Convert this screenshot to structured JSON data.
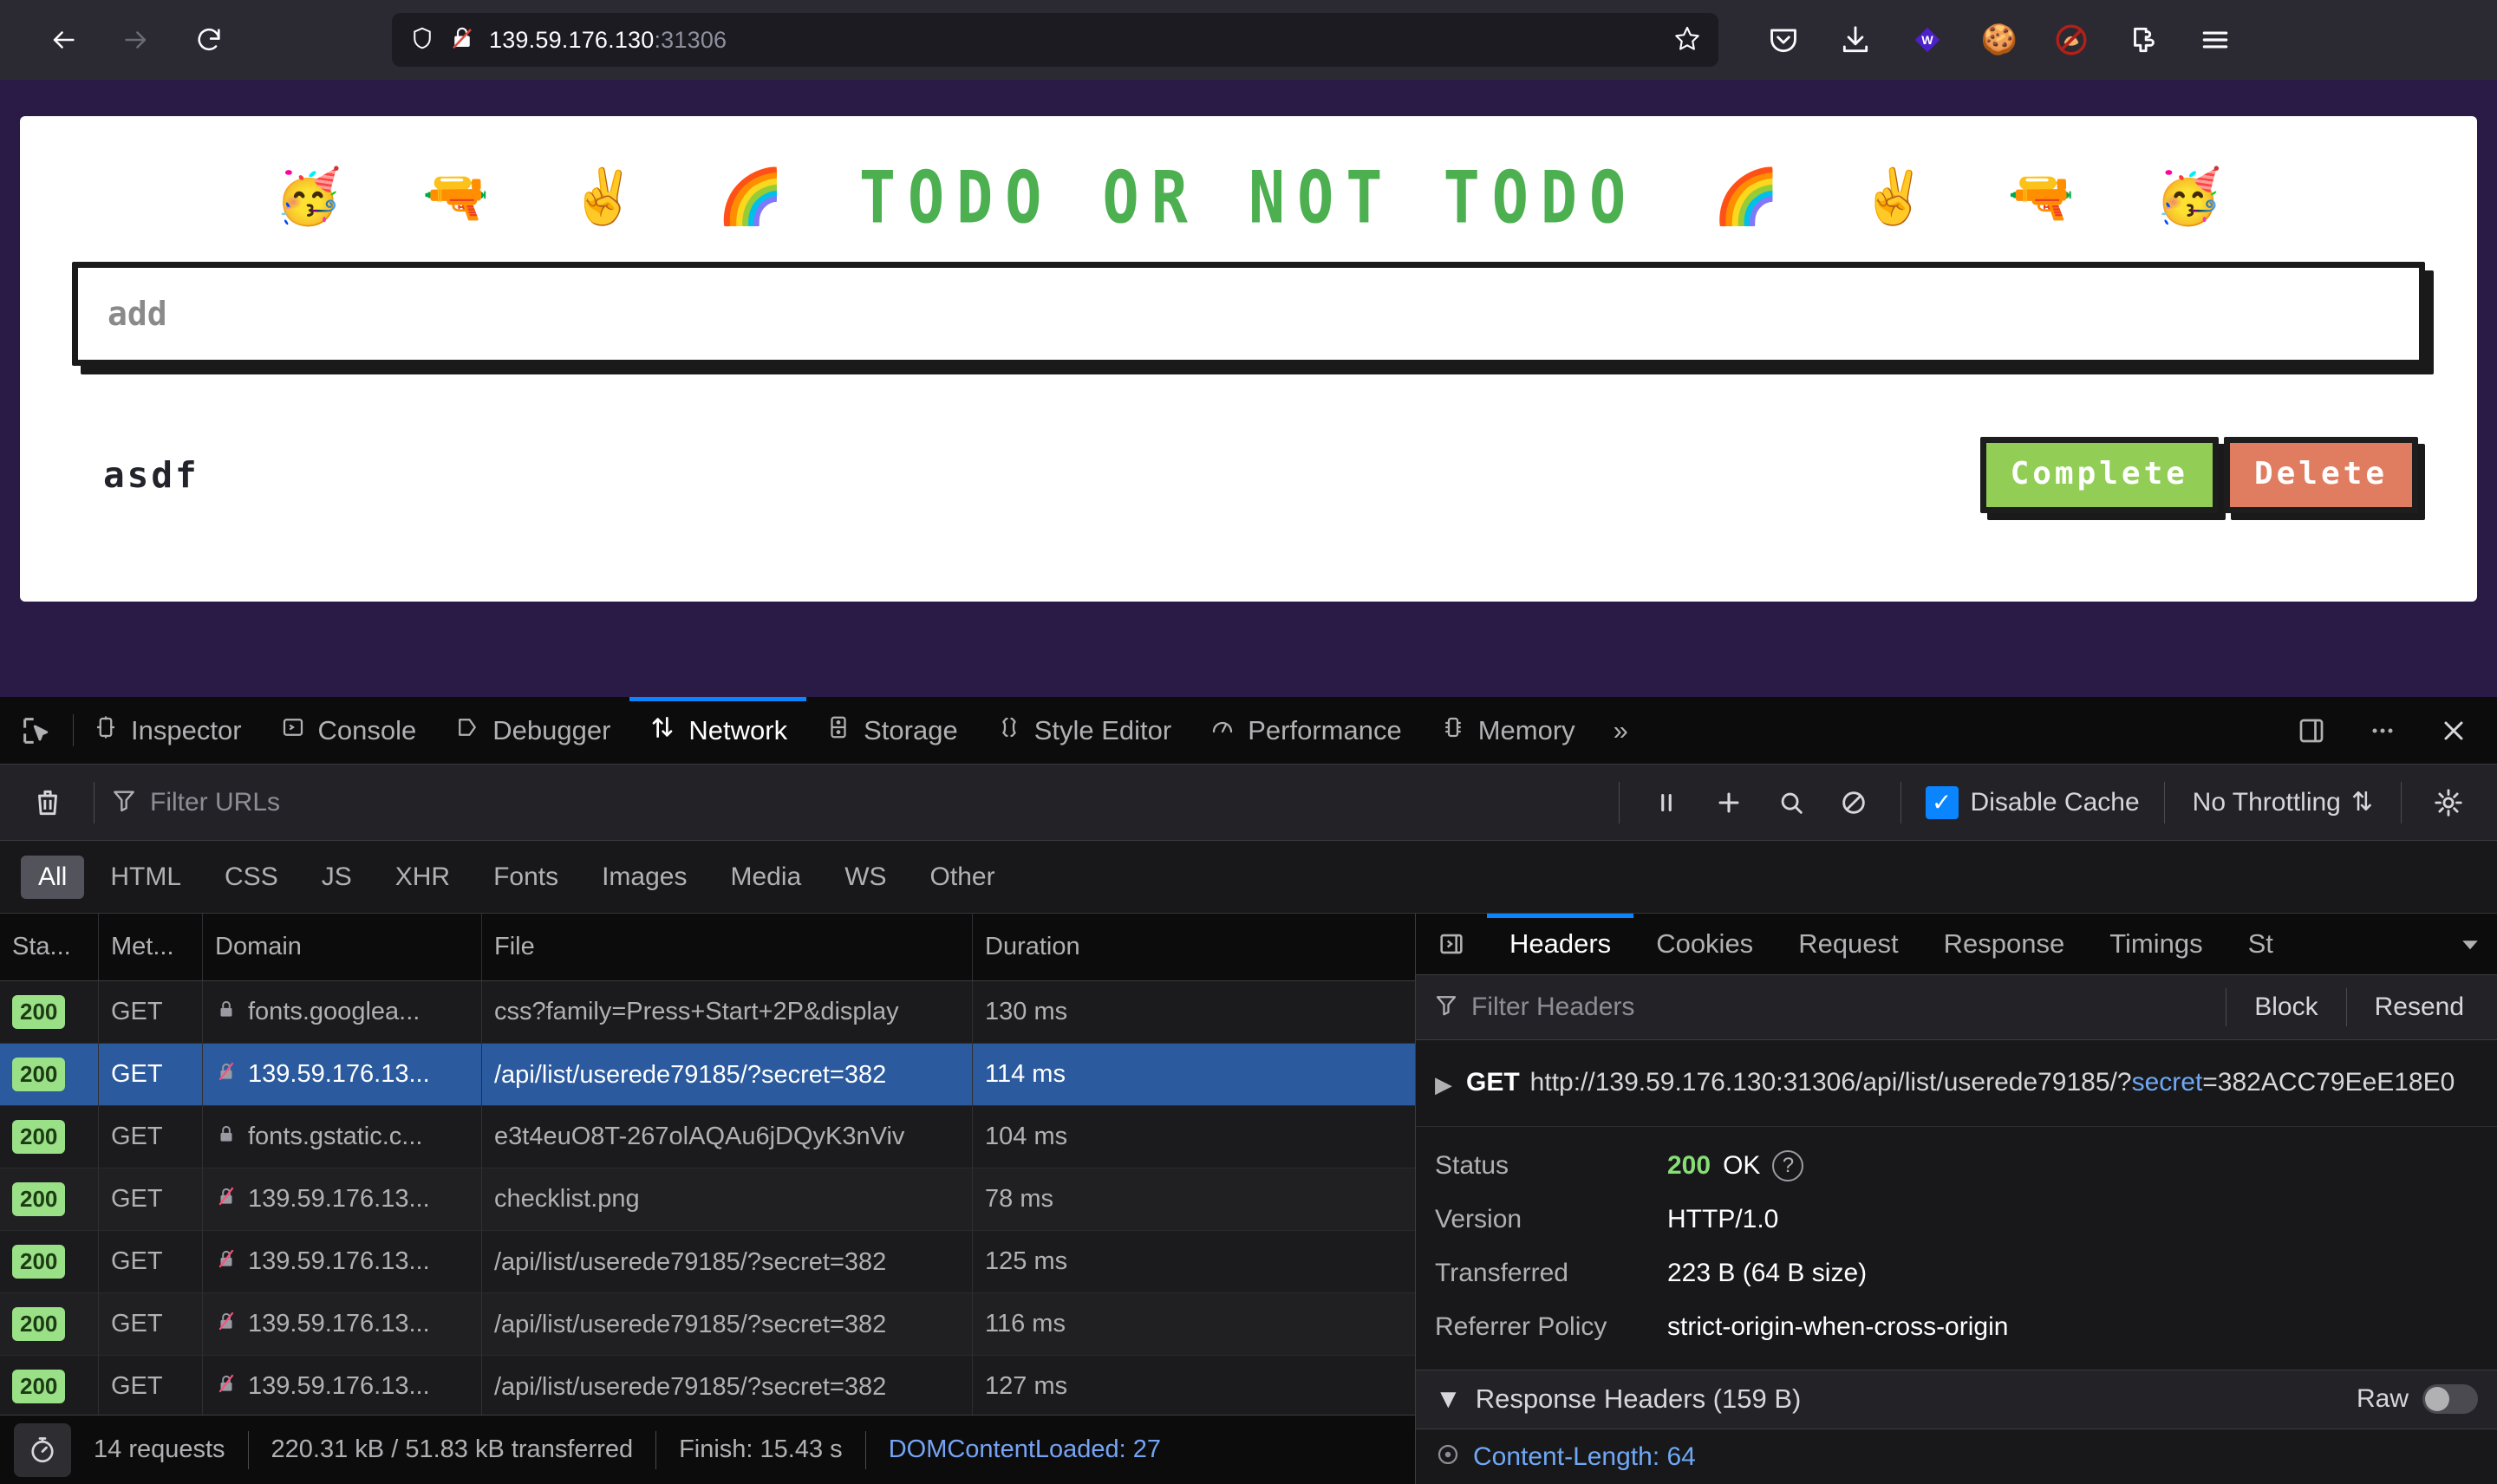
{
  "browser": {
    "url_host": "139.59.176.130",
    "url_port": ":31306",
    "nav": {
      "back": "back-arrow",
      "forward": "forward-arrow",
      "reload": "reload"
    },
    "toolbar_icons": [
      "pocket-icon",
      "downloads-icon",
      "wallet-extension-icon",
      "cookie-icon",
      "no-fox-icon",
      "extensions-puzzle-icon",
      "app-menu-icon"
    ]
  },
  "page": {
    "title": "TODO OR NOT TODO",
    "emoji_left": [
      "🥳",
      "🔫",
      "✌️",
      "🌈"
    ],
    "emoji_right": [
      "🌈",
      "✌️",
      "🔫",
      "🥳"
    ],
    "input_placeholder": "add",
    "input_value": "",
    "items": [
      {
        "label": "asdf",
        "complete_label": "Complete",
        "delete_label": "Delete"
      }
    ],
    "colors": {
      "title": "#4CAF50",
      "complete": "#92cd56",
      "delete": "#e07d61",
      "backdrop": "#2a1a46"
    }
  },
  "devtools": {
    "tabs": [
      {
        "label": "Inspector",
        "icon": "inspector-icon",
        "active": false
      },
      {
        "label": "Console",
        "icon": "console-icon",
        "active": false
      },
      {
        "label": "Debugger",
        "icon": "debugger-icon",
        "active": false
      },
      {
        "label": "Network",
        "icon": "network-icon",
        "active": true
      },
      {
        "label": "Storage",
        "icon": "storage-icon",
        "active": false
      },
      {
        "label": "Style Editor",
        "icon": "style-editor-icon",
        "active": false
      },
      {
        "label": "Performance",
        "icon": "performance-icon",
        "active": false
      },
      {
        "label": "Memory",
        "icon": "memory-icon",
        "active": false
      }
    ],
    "overflow_label": "»",
    "toolbar": {
      "filter_placeholder": "Filter URLs",
      "filter_value": "",
      "disable_cache_label": "Disable Cache",
      "disable_cache_checked": true,
      "throttling_label": "No Throttling"
    },
    "type_filters": [
      {
        "label": "All",
        "active": true
      },
      {
        "label": "HTML",
        "active": false
      },
      {
        "label": "CSS",
        "active": false
      },
      {
        "label": "JS",
        "active": false
      },
      {
        "label": "XHR",
        "active": false
      },
      {
        "label": "Fonts",
        "active": false
      },
      {
        "label": "Images",
        "active": false
      },
      {
        "label": "Media",
        "active": false
      },
      {
        "label": "WS",
        "active": false
      },
      {
        "label": "Other",
        "active": false
      }
    ],
    "columns": [
      "Sta...",
      "Met...",
      "Domain",
      "File",
      "Duration"
    ],
    "requests": [
      {
        "status": "200",
        "method": "GET",
        "domain": "fonts.googlea...",
        "file": "css?family=Press+Start+2P&display",
        "duration": "130 ms",
        "secure": true,
        "selected": false
      },
      {
        "status": "200",
        "method": "GET",
        "domain": "139.59.176.13...",
        "file": "/api/list/userede79185/?secret=382",
        "duration": "114 ms",
        "secure": false,
        "selected": true
      },
      {
        "status": "200",
        "method": "GET",
        "domain": "fonts.gstatic.c...",
        "file": "e3t4euO8T-267olAQAu6jDQyK3nViv",
        "duration": "104 ms",
        "secure": true,
        "selected": false
      },
      {
        "status": "200",
        "method": "GET",
        "domain": "139.59.176.13...",
        "file": "checklist.png",
        "duration": "78 ms",
        "secure": false,
        "selected": false
      },
      {
        "status": "200",
        "method": "GET",
        "domain": "139.59.176.13...",
        "file": "/api/list/userede79185/?secret=382",
        "duration": "125 ms",
        "secure": false,
        "selected": false
      },
      {
        "status": "200",
        "method": "GET",
        "domain": "139.59.176.13...",
        "file": "/api/list/userede79185/?secret=382",
        "duration": "116 ms",
        "secure": false,
        "selected": false
      },
      {
        "status": "200",
        "method": "GET",
        "domain": "139.59.176.13...",
        "file": "/api/list/userede79185/?secret=382",
        "duration": "127 ms",
        "secure": false,
        "selected": false
      }
    ],
    "statusbar": {
      "requests": "14 requests",
      "transferred": "220.31 kB / 51.83 kB transferred",
      "finish": "Finish: 15.43 s",
      "domcontentloaded": "DOMContentLoaded: 27"
    },
    "details": {
      "tabs": [
        {
          "label": "Headers",
          "active": true
        },
        {
          "label": "Cookies",
          "active": false
        },
        {
          "label": "Request",
          "active": false
        },
        {
          "label": "Response",
          "active": false
        },
        {
          "label": "Timings",
          "active": false
        },
        {
          "label": "St",
          "active": false
        }
      ],
      "filter_placeholder": "Filter Headers",
      "filter_value": "",
      "block_label": "Block",
      "resend_label": "Resend",
      "request_method": "GET",
      "request_url_prefix": "http://139.59.176.130:31306/api/list/userede79185/?",
      "request_url_query_key": "secret",
      "request_url_query_value": "=382ACC79EeE18E0",
      "fields": [
        {
          "key": "Status",
          "value": "200 OK",
          "code": "200",
          "text": "OK"
        },
        {
          "key": "Version",
          "value": "HTTP/1.0"
        },
        {
          "key": "Transferred",
          "value": "223 B (64 B size)"
        },
        {
          "key": "Referrer Policy",
          "value": "strict-origin-when-cross-origin"
        }
      ],
      "response_headers_label": "Response Headers (159 B)",
      "raw_label": "Raw",
      "raw_enabled": false,
      "first_response_header": "Content-Length: 64"
    }
  }
}
